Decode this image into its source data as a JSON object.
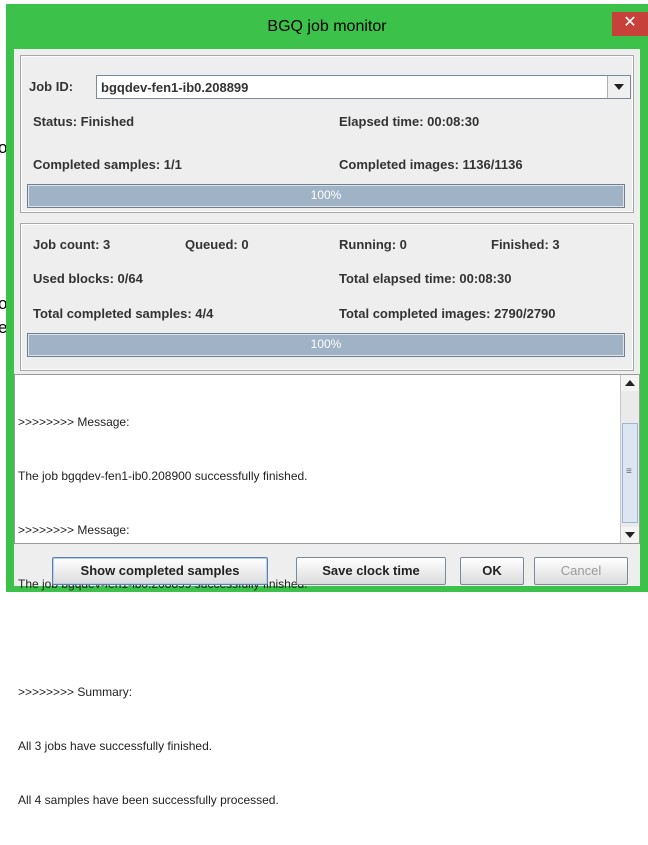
{
  "background_fragments": [
    "o",
    "o",
    "e"
  ],
  "window": {
    "title": "BGQ job monitor",
    "close_glyph": "✕"
  },
  "job_panel": {
    "job_id_label": "Job ID:",
    "job_id_value": "bgqdev-fen1-ib0.208899",
    "status": "Status: Finished",
    "elapsed_time": "Elapsed time: 00:08:30",
    "completed_samples": "Completed samples: 1/1",
    "completed_images": "Completed images: 1136/1136",
    "progress_text": "100%",
    "progress_fraction": 1.0
  },
  "summary_panel": {
    "job_count": "Job count: 3",
    "queued": "Queued: 0",
    "running": "Running: 0",
    "finished": "Finished: 3",
    "used_blocks": "Used blocks: 0/64",
    "total_elapsed": "Total elapsed time: 00:08:30",
    "total_samples": "Total completed samples: 4/4",
    "total_images": "Total completed images: 2790/2790",
    "progress_text": "100%",
    "progress_fraction": 1.0
  },
  "log": {
    "lines": [
      ">>>>>>>> Message:",
      "The job bgqdev-fen1-ib0.208900 successfully finished.",
      ">>>>>>>> Message:",
      "The job bgqdev-fen1-ib0.208899 successfully finished.",
      "",
      ">>>>>>>> Summary:",
      "All 3 jobs have successfully finished.",
      "All 4 samples have been successfully processed."
    ]
  },
  "buttons": {
    "show_completed": "Show completed samples",
    "save_clock": "Save clock time",
    "ok": "OK",
    "cancel": "Cancel"
  },
  "colors": {
    "window_frame": "#3cc14a",
    "close_button": "#c7413a",
    "progress_fill": "#9fb2c6"
  }
}
